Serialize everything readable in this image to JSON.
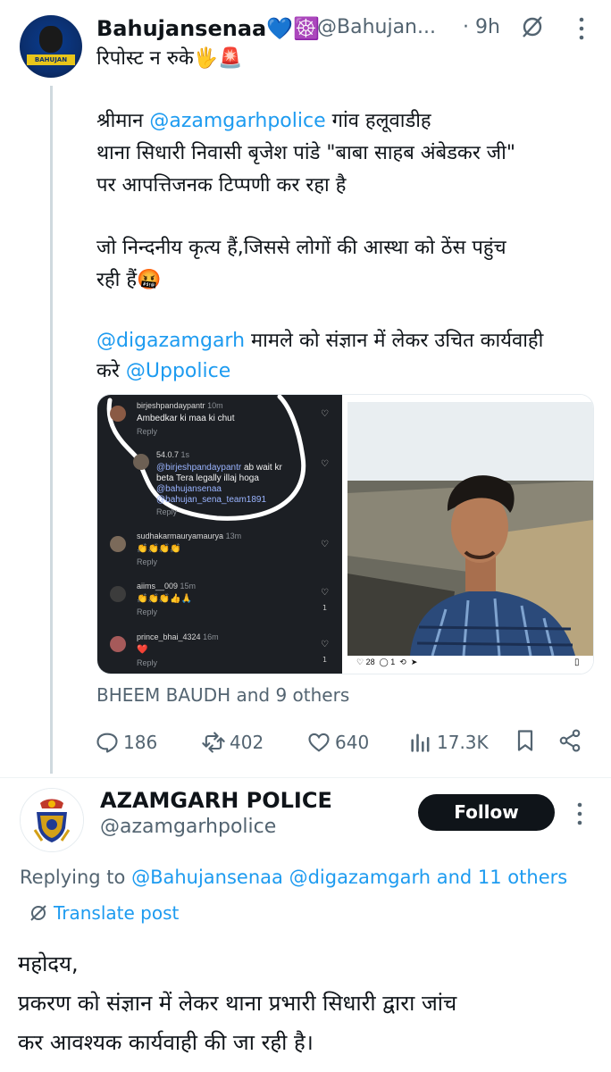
{
  "tweet": {
    "author_name": "Bahujansenaa💙☸️",
    "handle": "@Bahujan...",
    "time": "· 9h",
    "avatar_text": "BAHUJAN SENAA",
    "lines": [
      "रिपोस्ट न रुके🖐️🚨",
      "",
      "श्रीमान ",
      "थाना सिधारी निवासी बृजेश पांडे \"बाबा साहब अंबेडकर जी\"",
      "पर आपत्तिजनक टिप्पणी कर रहा है",
      "",
      "जो निन्दनीय कृत्य हैं,जिससे लोगों की आस्था को ठेंस पहुंच",
      "रही हैं🤬",
      "",
      " मामले को संज्ञान में लेकर उचित कार्यवाही",
      "करे "
    ],
    "mention_1": "@azamgarhpolice",
    "line3_tail": "  गांव हलूवाडीह",
    "mention_2": "@digazamgarh",
    "mention_3": "@Uppolice",
    "likes_text": "BHEEM BAUDH and 9 others",
    "replies": "186",
    "reposts": "402",
    "likes": "640",
    "views": "17.3K"
  },
  "screenshot_comments": [
    {
      "user": "birjeshpandaypantr",
      "time": "10m",
      "text": "Ambedkar ki maa ki chut",
      "reply": "Reply"
    },
    {
      "user": "54.0.7",
      "time": "1s",
      "mention": "@birjeshpandaypantr",
      "text": " ab wait kr",
      "text2": "beta Tera legally illaj hoga",
      "tag1": "@bahujansenaa",
      "tag2": "@bahujan_sena_team1891",
      "reply": "Reply"
    },
    {
      "user": "sudhakarmauryamaurya",
      "time": "13m",
      "text": "👏👏👏👏",
      "reply": "Reply"
    },
    {
      "user": "aiims__009",
      "time": "15m",
      "text": "👏👏👏👍🙏",
      "reply": "Reply",
      "count": "1"
    },
    {
      "user": "prince_bhai_4324",
      "time": "16m",
      "text": "❤️",
      "reply": "Reply",
      "count": "1"
    }
  ],
  "photo_post": {
    "likes": "28",
    "comments": "1"
  },
  "reply": {
    "author_name": "AZAMGARH POLICE",
    "handle": "@azamgarhpolice",
    "follow_label": "Follow",
    "replying_prefix": "Replying to ",
    "replying_to": "@Bahujansenaa @digazamgarh and 11 others",
    "translate_label": "Translate post",
    "lines": [
      "महोदय,",
      " प्रकरण को संज्ञान में लेकर थाना प्रभारी सिधारी द्वारा जांच",
      "कर आवश्यक कार्यवाही की जा रही है।"
    ]
  },
  "colors": {
    "accent": "#1d9bf0",
    "muted": "#536471",
    "text": "#0f1419"
  }
}
